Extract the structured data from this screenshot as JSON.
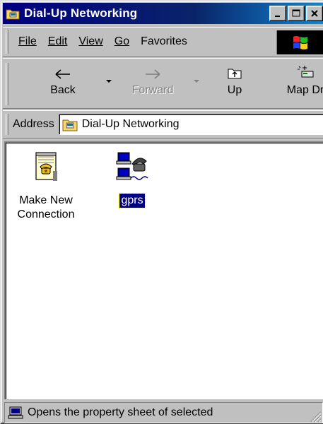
{
  "window": {
    "title": "Dial-Up Networking",
    "title_icon": "dialup-folder-icon"
  },
  "menubar": {
    "items": [
      {
        "label": "File"
      },
      {
        "label": "Edit"
      },
      {
        "label": "View"
      },
      {
        "label": "Go"
      },
      {
        "label": "Favorites"
      }
    ]
  },
  "toolbar": {
    "back_label": "Back",
    "forward_label": "Forward",
    "up_label": "Up",
    "mapdrive_label": "Map Dr"
  },
  "addressbar": {
    "label": "Address",
    "value": "Dial-Up Networking"
  },
  "content": {
    "items": [
      {
        "label_line1": "Make New",
        "label_line2": "Connection",
        "icon": "make-new-connection-icon"
      },
      {
        "label": "gprs",
        "icon": "dialup-connection-icon",
        "selected": true
      }
    ]
  },
  "statusbar": {
    "text": "Opens the property sheet of selected"
  },
  "colors": {
    "title_bar": "#000080",
    "selection": "#000080",
    "face": "#c0c0c0"
  }
}
